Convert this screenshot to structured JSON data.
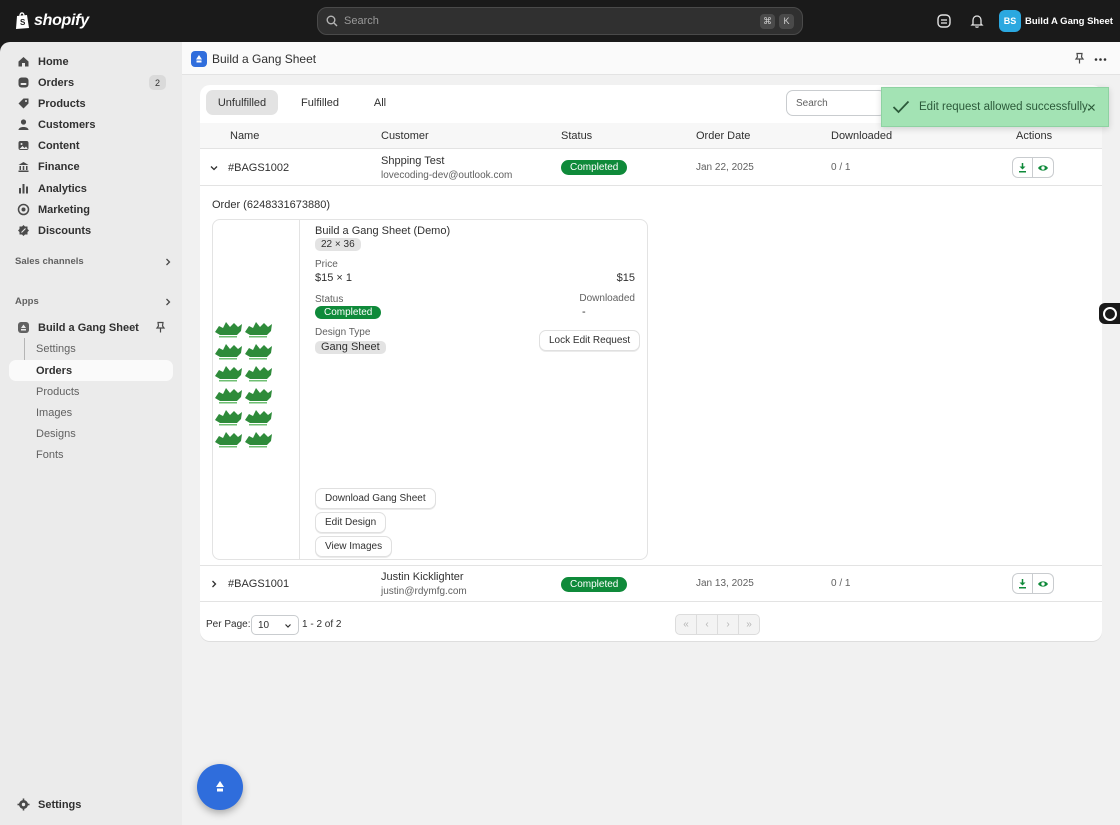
{
  "topbar": {
    "brand": "shopify",
    "search_placeholder": "Search",
    "shortcut_keys": [
      "⌘",
      "K"
    ],
    "store_initials": "BS",
    "store_name": "Build A Gang Sheet"
  },
  "sidebar": {
    "items": [
      {
        "label": "Home",
        "icon": "home-icon"
      },
      {
        "label": "Orders",
        "icon": "orders-icon",
        "badge": "2"
      },
      {
        "label": "Products",
        "icon": "tag-icon"
      },
      {
        "label": "Customers",
        "icon": "person-icon"
      },
      {
        "label": "Content",
        "icon": "content-icon"
      },
      {
        "label": "Finance",
        "icon": "finance-icon"
      },
      {
        "label": "Analytics",
        "icon": "analytics-icon"
      },
      {
        "label": "Marketing",
        "icon": "target-icon"
      },
      {
        "label": "Discounts",
        "icon": "discount-icon"
      }
    ],
    "sales_channels_label": "Sales channels",
    "apps_label": "Apps",
    "app_name": "Build a Gang Sheet",
    "app_subitems": [
      "Settings",
      "Orders",
      "Products",
      "Images",
      "Designs",
      "Fonts"
    ],
    "settings_label": "Settings"
  },
  "page": {
    "title": "Build a Gang Sheet"
  },
  "tabs": [
    "Unfulfilled",
    "Fulfilled",
    "All"
  ],
  "table_search_placeholder": "Search",
  "table": {
    "headers": [
      "Name",
      "Customer",
      "Status",
      "Order Date",
      "Downloaded",
      "Actions"
    ],
    "rows": [
      {
        "name": "#BAGS1002",
        "customer_name": "Shpping Test",
        "customer_email": "lovecoding-dev@outlook.com",
        "status": "Completed",
        "order_date": "Jan 22, 2025",
        "downloaded": "0 / 1"
      },
      {
        "name": "#BAGS1001",
        "customer_name": "Justin Kicklighter",
        "customer_email": "justin@rdymfg.com",
        "status": "Completed",
        "order_date": "Jan 13, 2025",
        "downloaded": "0 / 1"
      }
    ]
  },
  "order_detail": {
    "order_label": "Order (6248331673880)",
    "product_title": "Build a Gang Sheet (Demo)",
    "size": "22 × 36",
    "price_label": "Price",
    "price_value": "$15 × 1",
    "price_total": "$15",
    "status_label": "Status",
    "status_value": "Completed",
    "downloaded_label": "Downloaded",
    "downloaded_value": "-",
    "design_type_label": "Design Type",
    "design_type_value": "Gang Sheet",
    "lock_button": "Lock Edit Request",
    "download_button": "Download Gang Sheet",
    "edit_button": "Edit Design",
    "view_button": "View Images"
  },
  "pagination": {
    "per_page_label": "Per Page:",
    "per_page_value": "10",
    "range": "1 - 2 of 2"
  },
  "toast": {
    "message": "Edit request allowed successfully."
  },
  "colors": {
    "completed_badge": "#0f8a3a",
    "toast_bg": "#a3e3b4",
    "accent_blue": "#2f6ddc"
  }
}
